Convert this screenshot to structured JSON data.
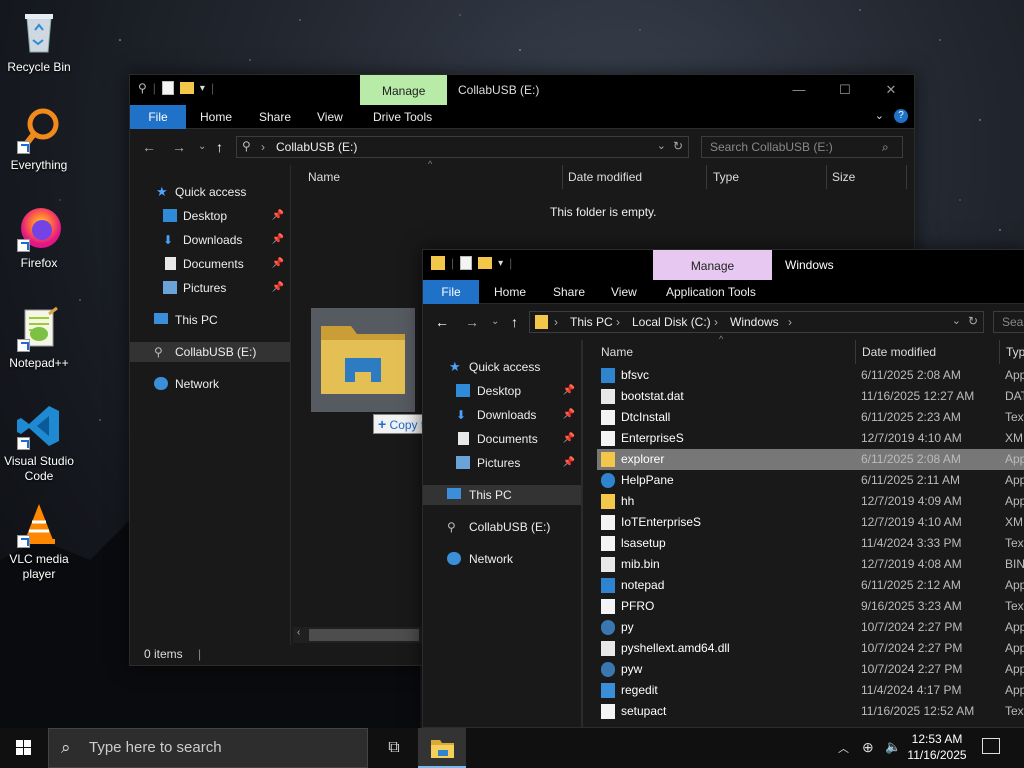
{
  "desktop": {
    "icons": [
      {
        "label": "Recycle Bin",
        "icon": "recycle-bin-icon"
      },
      {
        "label": "Everything",
        "icon": "everything-search-icon"
      },
      {
        "label": "Firefox",
        "icon": "firefox-icon"
      },
      {
        "label": "Notepad++",
        "icon": "notepad-plus-plus-icon"
      },
      {
        "label": "Visual Studio Code",
        "icon": "vscode-icon"
      },
      {
        "label": "VLC media player",
        "icon": "vlc-icon"
      }
    ]
  },
  "window_back": {
    "title": "CollabUSB (E:)",
    "manage_tab": "Manage",
    "ribbon": {
      "file": "File",
      "home": "Home",
      "share": "Share",
      "view": "View",
      "tools": "Drive Tools"
    },
    "address": {
      "location": "CollabUSB (E:)"
    },
    "search_placeholder": "Search CollabUSB (E:)",
    "nav": {
      "quick_access": "Quick access",
      "desktop": "Desktop",
      "downloads": "Downloads",
      "documents": "Documents",
      "pictures": "Pictures",
      "this_pc": "This PC",
      "usb": "CollabUSB (E:)",
      "network": "Network"
    },
    "columns": {
      "name": "Name",
      "date": "Date modified",
      "type": "Type",
      "size": "Size"
    },
    "empty_message": "This folder is empty.",
    "status": "0 items"
  },
  "drag": {
    "tooltip": "Copy to CollabUSB (E:)"
  },
  "window_front": {
    "title": "Windows",
    "manage_tab": "Manage",
    "ribbon": {
      "file": "File",
      "home": "Home",
      "share": "Share",
      "view": "View",
      "tools": "Application Tools"
    },
    "address": {
      "this_pc": "This PC",
      "disk": "Local Disk (C:)",
      "folder": "Windows"
    },
    "search_placeholder": "Sear",
    "nav": {
      "quick_access": "Quick access",
      "desktop": "Desktop",
      "downloads": "Downloads",
      "documents": "Documents",
      "pictures": "Pictures",
      "this_pc": "This PC",
      "usb": "CollabUSB (E:)",
      "network": "Network"
    },
    "columns": {
      "name": "Name",
      "date": "Date modified",
      "type": "Typ"
    },
    "files": [
      {
        "name": "bfsvc",
        "date": "6/11/2025 2:08 AM",
        "type": "App",
        "icon": "app-icon"
      },
      {
        "name": "bootstat.dat",
        "date": "11/16/2025 12:27 AM",
        "type": "DAT",
        "icon": "file-icon"
      },
      {
        "name": "DtcInstall",
        "date": "6/11/2025 2:23 AM",
        "type": "Text",
        "icon": "text-file-icon"
      },
      {
        "name": "EnterpriseS",
        "date": "12/7/2019 4:10 AM",
        "type": "XM",
        "icon": "xml-file-icon"
      },
      {
        "name": "explorer",
        "date": "6/11/2025 2:08 AM",
        "type": "App",
        "icon": "explorer-icon"
      },
      {
        "name": "HelpPane",
        "date": "6/11/2025 2:11 AM",
        "type": "App",
        "icon": "help-icon"
      },
      {
        "name": "hh",
        "date": "12/7/2019 4:09 AM",
        "type": "App",
        "icon": "hh-icon"
      },
      {
        "name": "IoTEnterpriseS",
        "date": "12/7/2019 4:10 AM",
        "type": "XM",
        "icon": "xml-file-icon"
      },
      {
        "name": "lsasetup",
        "date": "11/4/2024 3:33 PM",
        "type": "Text",
        "icon": "text-file-icon"
      },
      {
        "name": "mib.bin",
        "date": "12/7/2019 4:08 AM",
        "type": "BIN",
        "icon": "file-icon"
      },
      {
        "name": "notepad",
        "date": "6/11/2025 2:12 AM",
        "type": "App",
        "icon": "app-icon"
      },
      {
        "name": "PFRO",
        "date": "9/16/2025 3:23 AM",
        "type": "Text",
        "icon": "text-file-icon"
      },
      {
        "name": "py",
        "date": "10/7/2024 2:27 PM",
        "type": "App",
        "icon": "python-icon"
      },
      {
        "name": "pyshellext.amd64.dll",
        "date": "10/7/2024 2:27 PM",
        "type": "App",
        "icon": "dll-icon"
      },
      {
        "name": "pyw",
        "date": "10/7/2024 2:27 PM",
        "type": "App",
        "icon": "python-icon"
      },
      {
        "name": "regedit",
        "date": "11/4/2024 4:17 PM",
        "type": "App",
        "icon": "regedit-icon"
      },
      {
        "name": "setupact",
        "date": "11/16/2025 12:52 AM",
        "type": "Text",
        "icon": "text-file-icon"
      }
    ]
  },
  "taskbar": {
    "search_placeholder": "Type here to search",
    "time": "12:53 AM",
    "date": "11/16/2025"
  }
}
